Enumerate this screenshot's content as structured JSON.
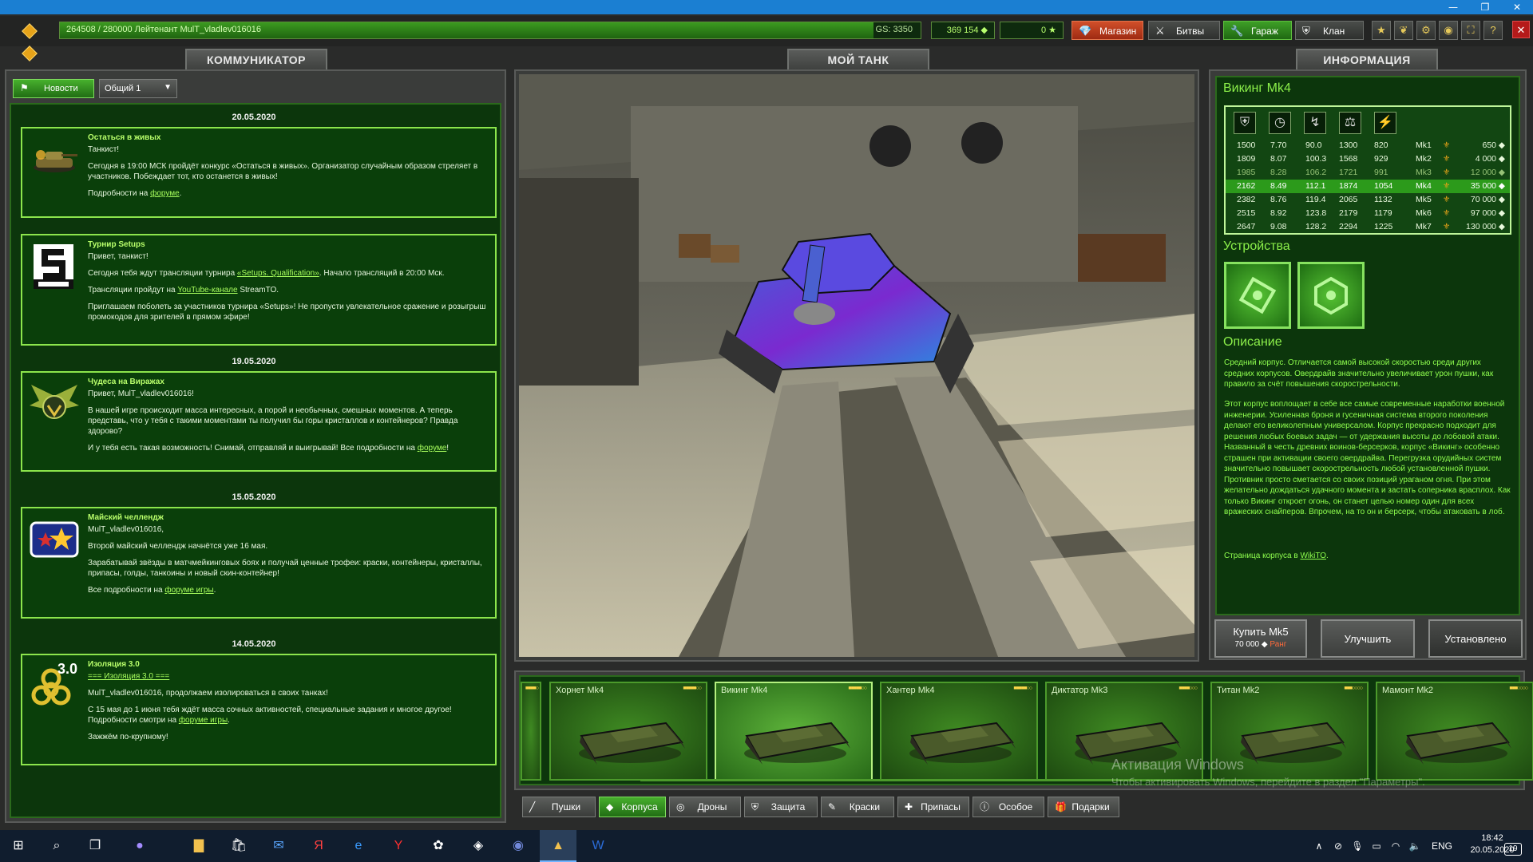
{
  "topbar": {
    "xp_text": "264508 / 280000   Лейтенант MulT_vladlev016016",
    "xp_progress": 0.945,
    "gs": "GS: 3350",
    "crystals": "369 154 ◆",
    "stars": "0 ★",
    "shop": "Магазин",
    "battles": "Битвы",
    "garage": "Гараж",
    "clan": "Клан"
  },
  "communicator": {
    "title": "КОММУНИКАТОР",
    "news_tab": "Новости",
    "channel": "Общий 1",
    "items": [
      {
        "date": "20.05.2020",
        "title": "Остаться в живых",
        "greeting": "Танкист!",
        "paragraphs": [
          "Сегодня в 19:00 МСК пройдёт конкурс «Остаться в живых». Организатор случайным образом стреляет в участников. Побеждает тот, кто останется в живых!"
        ],
        "link_prefix": "Подробности на ",
        "link": "форуме",
        "link_suffix": "."
      },
      {
        "date": "",
        "title": "Турнир  Setups",
        "greeting": "Привет, танкист!",
        "p1_prefix": "Сегодня тебя ждут трансляции турнира ",
        "p1_link": "«Setups. Qualification»",
        "p1_suffix": ". Начало трансляций в 20:00 Мск.",
        "p2_prefix": "Трансляции пройдут на ",
        "p2_link": "YouTube-канале",
        "p2_suffix": " StreamTO.",
        "p3": "Приглашаем поболеть за участников турнира «Setups»! Не пропусти увлекательное сражение и розыгрыш промокодов для зрителей в прямом эфире!"
      },
      {
        "date": "19.05.2020",
        "title": "Чудеса на Виражах",
        "greeting": "Привет, MulT_vladlev016016!",
        "p1": "В нашей игре происходит масса интересных, а порой и необычных, смешных моментов. А теперь представь, что у тебя с такими моментами ты получил бы горы кристаллов и контейнеров? Правда здорово?",
        "p2_prefix": " И у тебя есть такая возможность! Снимай, отправляй и выигрывай! Все подробности на ",
        "p2_link": "форуме",
        "p2_suffix": "!"
      },
      {
        "date": "15.05.2020",
        "title": " Майский челлендж",
        "greeting": "MulT_vladlev016016,",
        "p1": "Второй майский челлендж начнётся уже 16 мая.",
        "p2": "Зарабатывай звёзды в матчмейкинговых боях и получай ценные трофеи: краски, контейнеры, кристаллы, припасы, голды, танкоины и новый скин-контейнер!",
        "p3_prefix": "Все подробности на  ",
        "p3_link": "форуме игры",
        "p3_suffix": "."
      },
      {
        "date": "14.05.2020",
        "title": "Изоляция 3.0",
        "link_line": "=== Изоляция 3.0 ===",
        "p1": "MulT_vladlev016016, продолжаем изолироваться в своих танках!",
        "p2_prefix": "С 15 мая до 1 июня тебя ждёт масса сочных активностей, специальные задания и многое другое! Подробности смотри на ",
        "p2_link": "форуме игры",
        "p2_suffix": ".",
        "p3": "Зажжём по-крупному!",
        "icon_text": "3.0"
      }
    ]
  },
  "mytank": {
    "title": "МОЙ ТАНК"
  },
  "info": {
    "title": "ИНФОРМАЦИЯ",
    "item_name": "Викинг Mk4",
    "stat_icons": [
      "shield-icon",
      "speed-icon",
      "turn-icon",
      "weight-icon",
      "power-icon"
    ],
    "rows": [
      {
        "v": [
          "1500",
          "7.70",
          "90.0",
          "1300",
          "820"
        ],
        "mk": "Mk1",
        "price": "650 ◆",
        "state": ""
      },
      {
        "v": [
          "1809",
          "8.07",
          "100.3",
          "1568",
          "929"
        ],
        "mk": "Mk2",
        "price": "4 000 ◆",
        "state": ""
      },
      {
        "v": [
          "1985",
          "8.28",
          "106.2",
          "1721",
          "991"
        ],
        "mk": "Mk3",
        "price": "12 000 ◆",
        "state": "dim"
      },
      {
        "v": [
          "2162",
          "8.49",
          "112.1",
          "1874",
          "1054"
        ],
        "mk": "Mk4",
        "price": "35 000 ◆",
        "state": "cur"
      },
      {
        "v": [
          "2382",
          "8.76",
          "119.4",
          "2065",
          "1132"
        ],
        "mk": "Mk5",
        "price": "70 000 ◆",
        "state": ""
      },
      {
        "v": [
          "2515",
          "8.92",
          "123.8",
          "2179",
          "1179"
        ],
        "mk": "Mk6",
        "price": "97 000 ◆",
        "state": ""
      },
      {
        "v": [
          "2647",
          "9.08",
          "128.2",
          "2294",
          "1225"
        ],
        "mk": "Mk7",
        "price": "130 000 ◆",
        "state": ""
      }
    ],
    "devices_title": "Устройства",
    "description_title": "Описание",
    "desc1": "Средний корпус. Отличается самой высокой скоростью среди других средних корпусов. Овердрайв значительно увеличивает урон пушки, как правило за счёт повышения скорострельности.",
    "desc2": "Этот корпус воплощает в себе все самые современные наработки военной инженерии. Усиленная броня и гусеничная система второго поколения делают его великолепным универсалом. Корпус прекрасно подходит для решения любых боевых задач — от удержания высоты до лобовой атаки. Названный в честь древних воинов-берсерков, корпус «Викинг» особенно страшен при активации своего овердрайва. Перегрузка орудийных систем значительно повышает скорострельность любой установленной пушки. Противник просто сметается со своих позиций ураганом огня. При этом желательно дождаться удачного момента и застать соперника врасплох. Как только Викинг откроет огонь, он станет целью номер один для всех вражеских снайперов. Впрочем, на то он и берсерк, чтобы атаковать в лоб.",
    "wiki_prefix": "Страница корпуса в ",
    "wiki_link": "WikiTO",
    "wiki_suffix": ".",
    "buy_label": "Купить Mk5",
    "buy_price": "70 000 ◆",
    "buy_rank": "Ранг",
    "upgrade_label": "Улучшить",
    "installed_label": "Установлено"
  },
  "hulls": [
    {
      "name": "Хорнет Mk4",
      "stars": "■■■■■○○",
      "selected": false
    },
    {
      "name": "Викинг Mk4",
      "stars": "■■■■■○○",
      "selected": true
    },
    {
      "name": "Хантер Mk4",
      "stars": "■■■■■○○",
      "selected": false
    },
    {
      "name": "Диктатор Mk3",
      "stars": "■■■■○○○",
      "selected": false
    },
    {
      "name": "Титан Mk2",
      "stars": "■■■○○○○",
      "selected": false
    },
    {
      "name": "Мамонт Mk2",
      "stars": "■■■○○○○",
      "selected": false
    }
  ],
  "partial_card_stars": "■■■■○",
  "categories": [
    "Пушки",
    "Корпуса",
    "Дроны",
    "Защита",
    "Краски",
    "Припасы",
    "Особое",
    "Подарки"
  ],
  "watermark": {
    "line1": "Активация Windows",
    "line2": "Чтобы активировать Windows, перейдите в раздел \"Параметры\"."
  },
  "taskbar": {
    "lang": "ENG",
    "time": "18:42",
    "date": "20.05.2020",
    "notif": "19"
  }
}
